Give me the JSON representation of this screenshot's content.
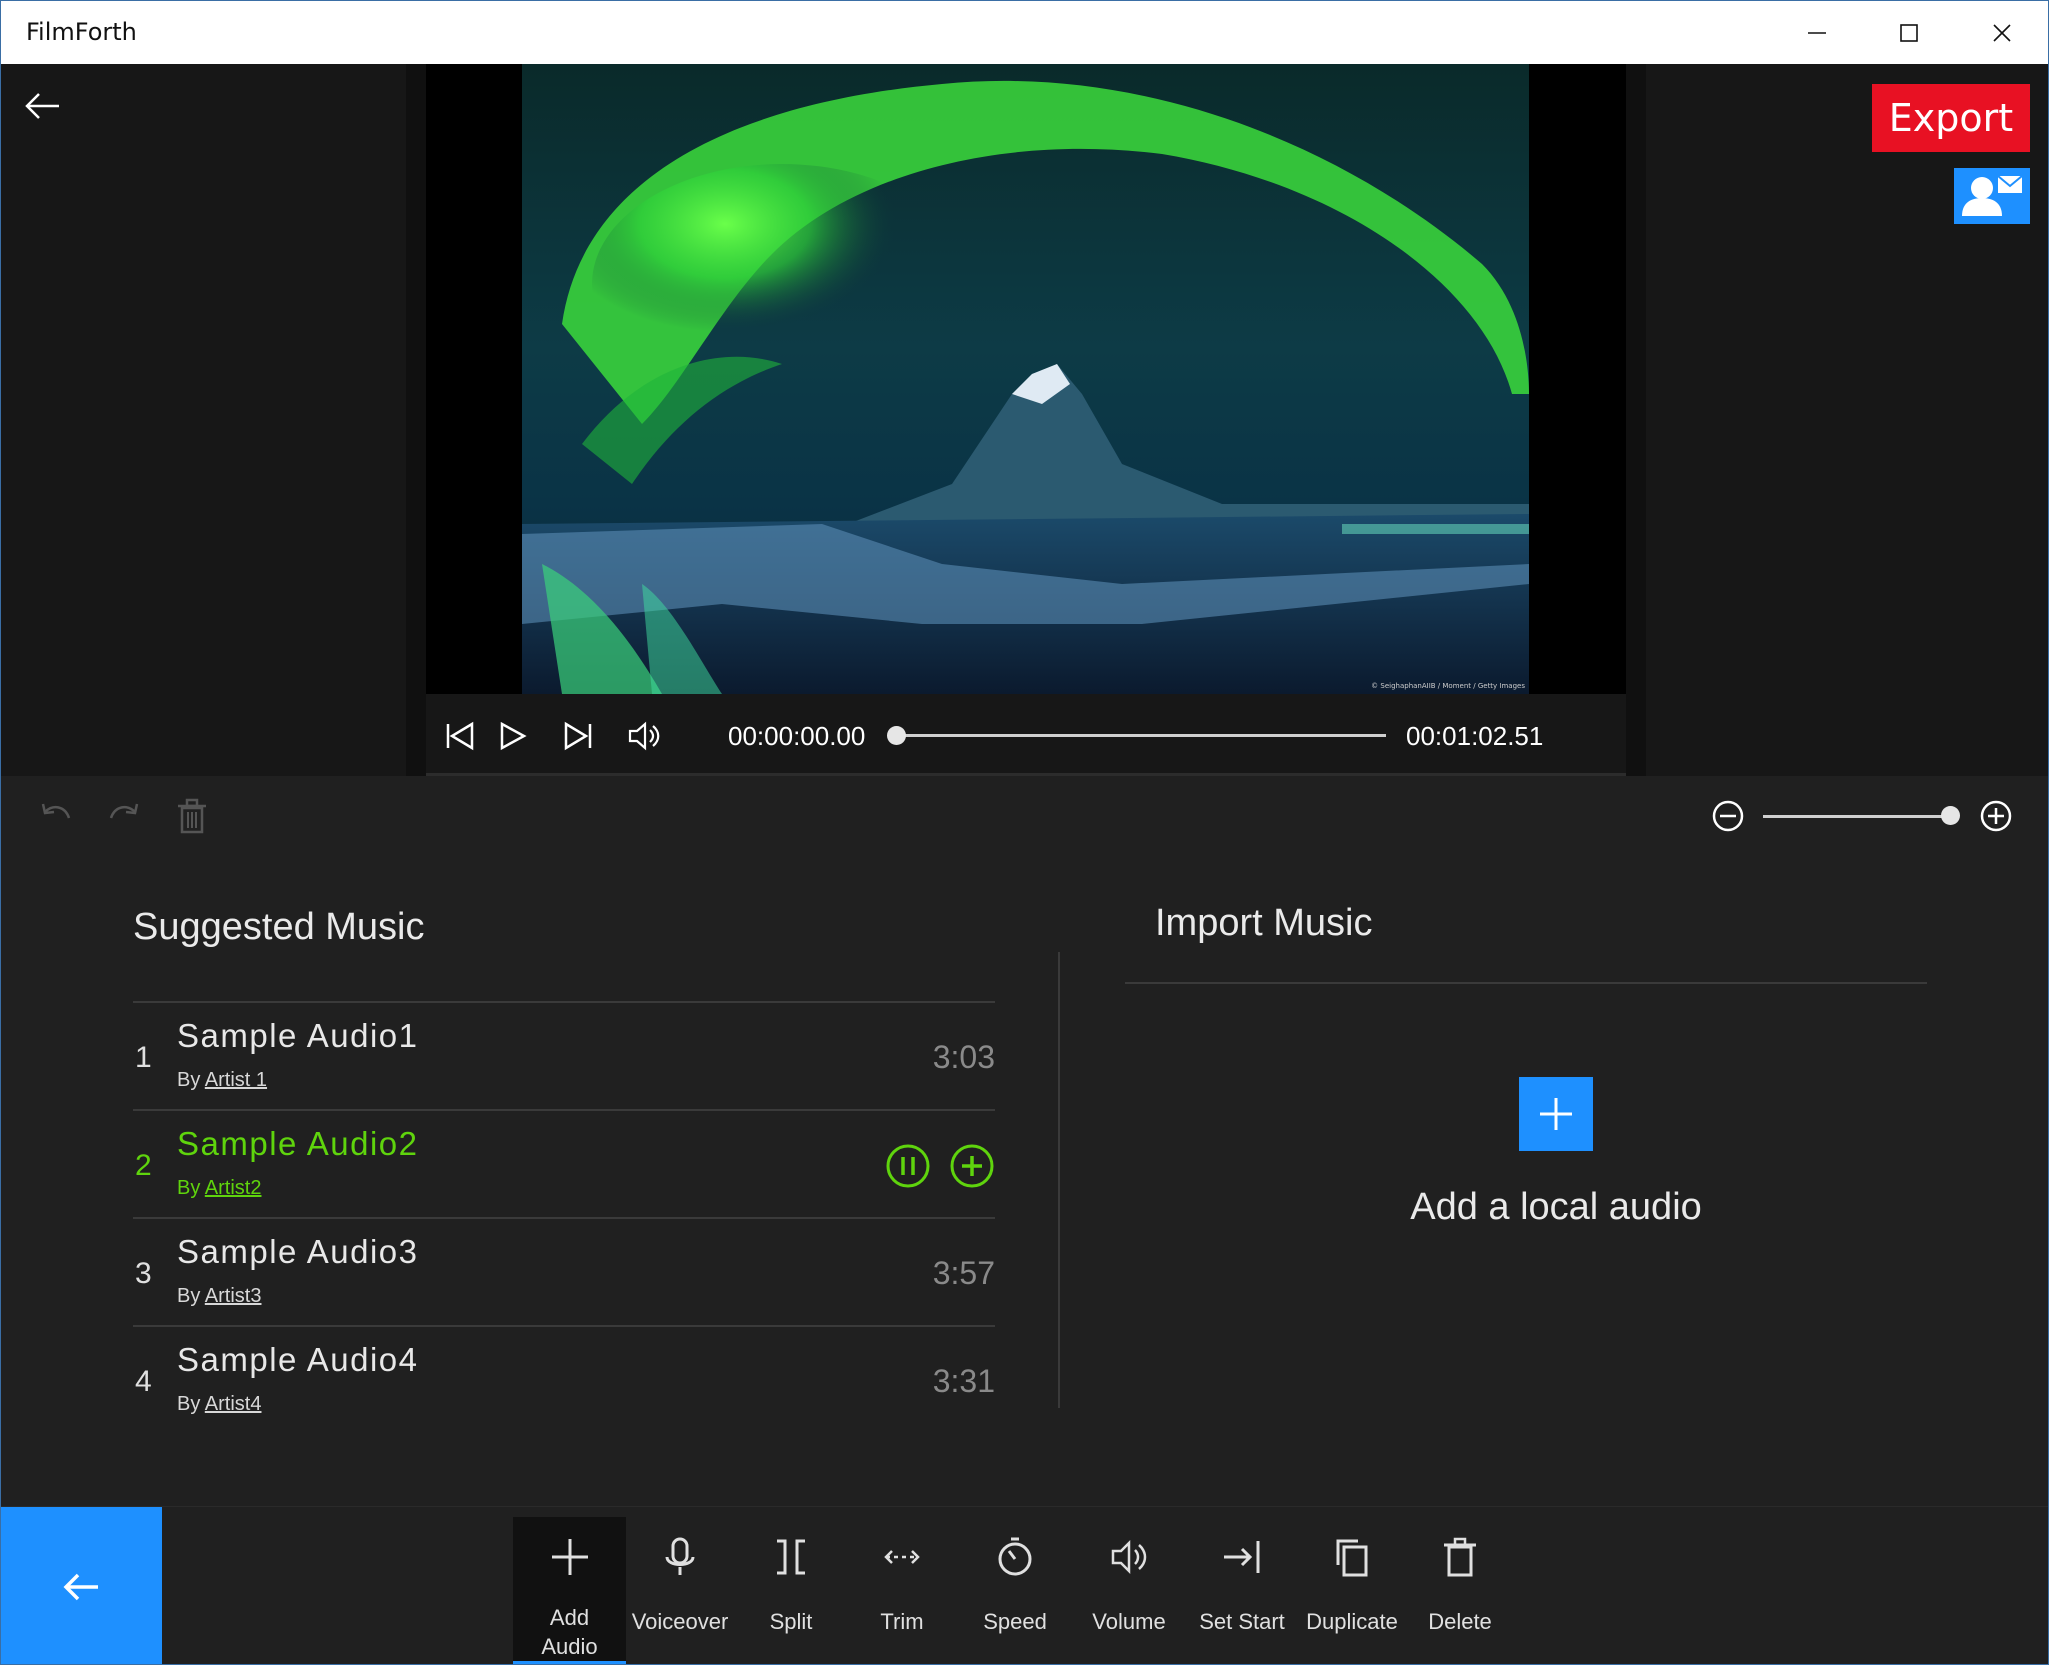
{
  "window": {
    "title": "FilmForth"
  },
  "header": {
    "export_label": "Export"
  },
  "preview": {
    "credit": "© SeighaphanAIIB / Moment / Getty Images",
    "current_time": "00:00:00.00",
    "total_time": "00:01:02.51",
    "progress": 0.0
  },
  "zoom": {
    "level": 1.0
  },
  "suggested": {
    "title": "Suggested Music",
    "by_prefix": "By",
    "tracks": [
      {
        "num": "1",
        "name": "Sample Audio1",
        "artist": "Artist 1",
        "duration": "3:03"
      },
      {
        "num": "2",
        "name": "Sample Audio2",
        "artist": "Artist2",
        "duration": ""
      },
      {
        "num": "3",
        "name": "Sample Audio3",
        "artist": "Artist3",
        "duration": "3:57"
      },
      {
        "num": "4",
        "name": "Sample Audio4",
        "artist": "Artist4",
        "duration": "3:31"
      }
    ]
  },
  "import": {
    "title": "Import Music",
    "add_label": "Add a local audio"
  },
  "toolbar": {
    "add_audio": "Add\nAudio",
    "voiceover": "Voiceover",
    "split": "Split",
    "trim": "Trim",
    "speed": "Speed",
    "volume": "Volume",
    "set_start": "Set Start",
    "duplicate": "Duplicate",
    "delete": "Delete"
  },
  "colors": {
    "accent": "#1e90ff",
    "export": "#e81123",
    "active_track": "#5fd40d"
  }
}
